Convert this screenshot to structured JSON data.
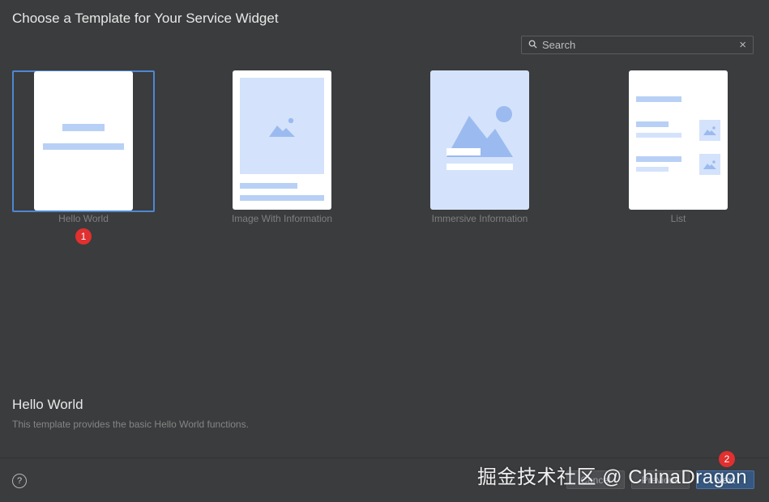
{
  "dialog": {
    "title": "Choose a Template for Your Service Widget"
  },
  "search": {
    "placeholder": "Search",
    "clear_icon": "×"
  },
  "templates": [
    {
      "label": "Hello World",
      "selected": true
    },
    {
      "label": "Image With Information",
      "selected": false
    },
    {
      "label": "Immersive Information",
      "selected": false
    },
    {
      "label": "List",
      "selected": false
    }
  ],
  "description": {
    "title": "Hello World",
    "text": "This template provides the basic Hello World functions."
  },
  "footer": {
    "help_label": "?",
    "cancel_label": "Cancel",
    "previous_label": "Previous",
    "next_label": "Next"
  },
  "badges": [
    "1",
    "2"
  ],
  "watermark": "掘金技术社区 @ ChinaDragon",
  "colors": {
    "background": "#3b3c3e",
    "accent": "#4e88d1",
    "badge": "#e0302f",
    "placeholder_blue": "#b8d0f5"
  }
}
